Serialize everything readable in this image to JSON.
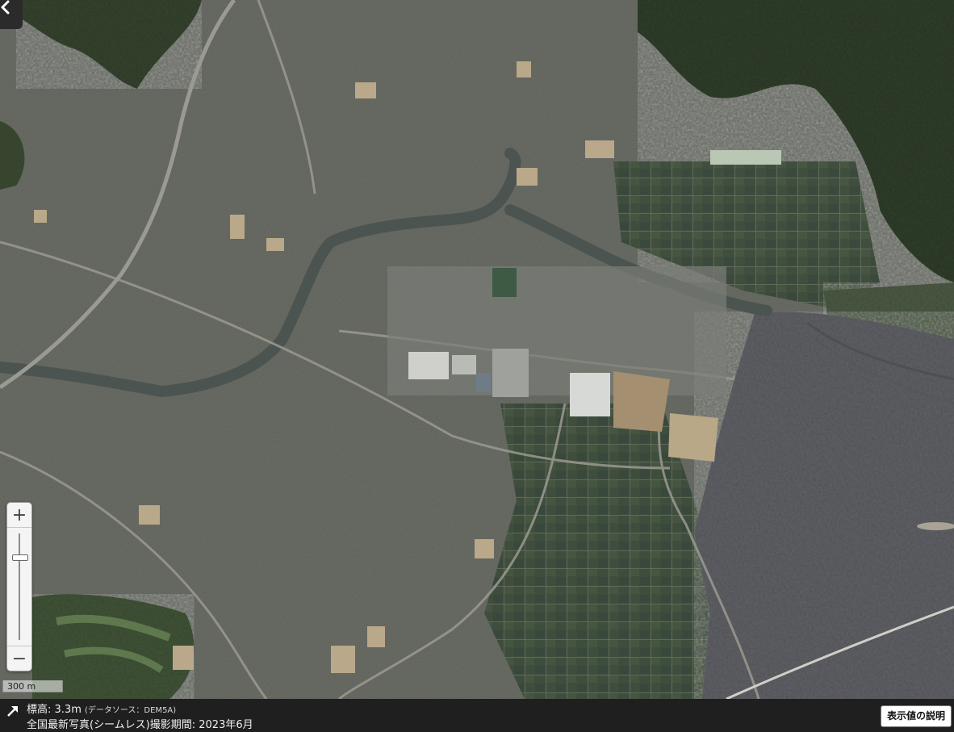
{
  "map": {
    "type": "aerial-photo",
    "features": [
      "residential-area",
      "river",
      "industrial-zone",
      "farmland",
      "tidal-flat",
      "forest-hills",
      "highway",
      "golf-course",
      "sea-dike"
    ]
  },
  "controls": {
    "back_icon": "chevron-left-icon",
    "zoom_in_label": "+",
    "zoom_out_label": "−",
    "zoom_level_fraction": 0.22
  },
  "scale": {
    "label": "300 m"
  },
  "info": {
    "expand_icon": "expand-arrow-icon",
    "elevation_label": "標高:",
    "elevation_value": "3.3m",
    "elevation_source": "(データソース：DEM5A)",
    "photo_period": "全国最新写真(シームレス)撮影期間: 2023年6月",
    "explain_button": "表示値の説明"
  },
  "colors": {
    "urban": "#6e7169",
    "forest": "#2f3d29",
    "sea": "#5f6066",
    "river": "#4e5552",
    "farm": "#3f4e3a",
    "info_bar": "#1f1f1f"
  }
}
